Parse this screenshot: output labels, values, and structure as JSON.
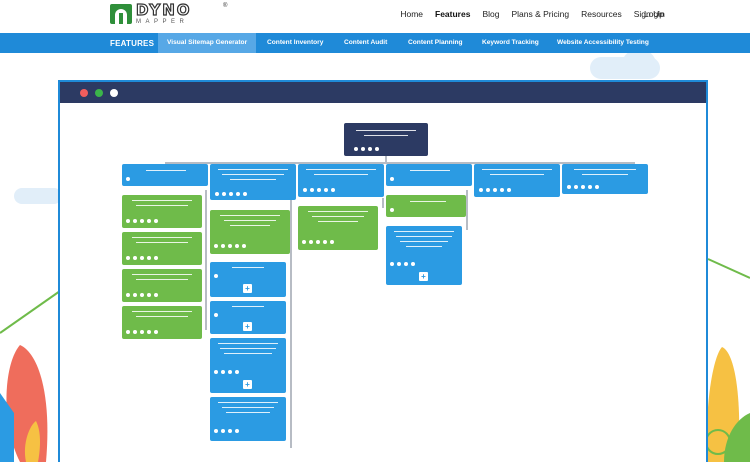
{
  "header": {
    "logo_text": "DYNO",
    "logo_subtext": "MAPPER",
    "logo_reg": "®",
    "nav_items": [
      {
        "label": "Home",
        "active": false
      },
      {
        "label": "Features",
        "active": true
      },
      {
        "label": "Blog",
        "active": false
      },
      {
        "label": "Plans & Pricing",
        "active": false
      },
      {
        "label": "Resources",
        "active": false
      },
      {
        "label": "Sign Up",
        "active": false
      }
    ],
    "login_label": "Login"
  },
  "subnav": {
    "title": "FEATURES",
    "tabs": [
      {
        "label": "Visual Sitemap Generator",
        "active": true
      },
      {
        "label": "Content Inventory",
        "active": false
      },
      {
        "label": "Content Audit",
        "active": false
      },
      {
        "label": "Content Planning",
        "active": false
      },
      {
        "label": "Keyword Tracking",
        "active": false
      },
      {
        "label": "Website Accessibility Testing",
        "active": false
      }
    ]
  },
  "colors": {
    "accent": "#1f8ad8",
    "navy": "#2c3a63",
    "card_blue": "#2b9be3",
    "card_green": "#6fbb4a"
  },
  "illustration": {
    "window_controls": [
      "close-dot",
      "minimize-dot",
      "maximize-dot"
    ],
    "expand_icon": "+"
  }
}
